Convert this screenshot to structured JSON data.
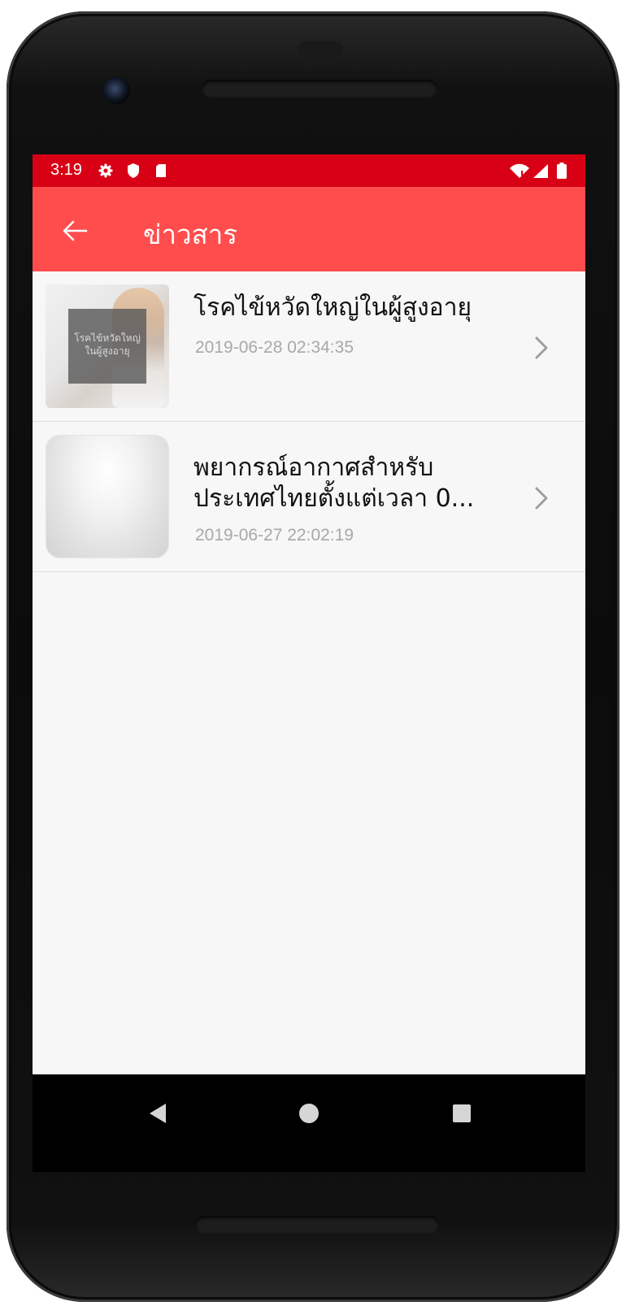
{
  "status_bar": {
    "time": "3:19",
    "left_icons": [
      "settings-icon",
      "shield-icon",
      "sd-card-icon"
    ],
    "right_icons": [
      "wifi-icon",
      "signal-icon",
      "battery-icon"
    ],
    "color": "#d70015"
  },
  "app_bar": {
    "title": "ข่าวสาร",
    "back_icon": "arrow-left-icon",
    "color": "#ff4d4d"
  },
  "news": [
    {
      "title_lines": [
        "โรคไข้หวัดใหญ่ในผู้สูงอายุ"
      ],
      "date": "2019-06-28 02:34:35",
      "thumbnail_text": "โรคไข้หวัดใหญ่ ในผู้สูงอายุ"
    },
    {
      "title_lines": [
        "พยากรณ์อากาศสำหรับ",
        "ประเทศไทยตั้งแต่เวลา 0..."
      ],
      "date": "2019-06-27 22:02:19"
    }
  ],
  "nav_bar": {
    "buttons": [
      "back-triangle-icon",
      "home-circle-icon",
      "recents-square-icon"
    ]
  }
}
